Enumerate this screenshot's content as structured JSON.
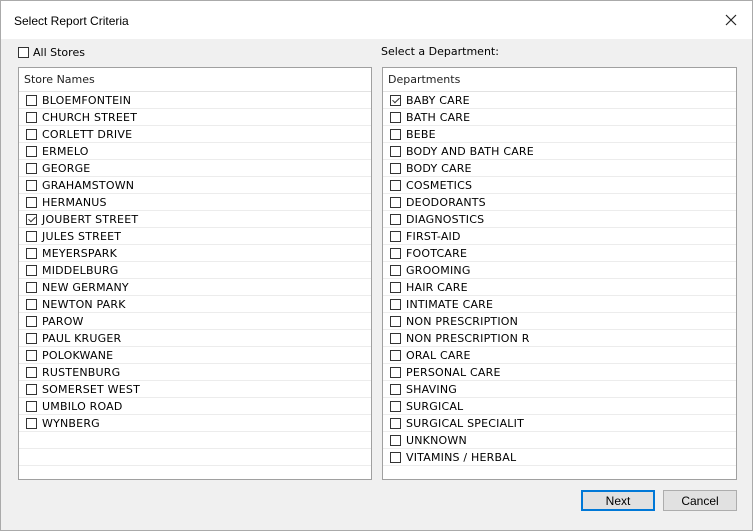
{
  "window": {
    "title": "Select Report Criteria"
  },
  "all_stores": {
    "label": "All Stores",
    "checked": false
  },
  "department_prompt": "Select a Department:",
  "stores": {
    "header": "Store Names",
    "items": [
      {
        "label": "BLOEMFONTEIN",
        "checked": false
      },
      {
        "label": "CHURCH STREET",
        "checked": false
      },
      {
        "label": "CORLETT DRIVE",
        "checked": false
      },
      {
        "label": "ERMELO",
        "checked": false
      },
      {
        "label": "GEORGE",
        "checked": false
      },
      {
        "label": "GRAHAMSTOWN",
        "checked": false
      },
      {
        "label": "HERMANUS",
        "checked": false
      },
      {
        "label": "JOUBERT STREET",
        "checked": true
      },
      {
        "label": "JULES STREET",
        "checked": false
      },
      {
        "label": "MEYERSPARK",
        "checked": false
      },
      {
        "label": "MIDDELBURG",
        "checked": false
      },
      {
        "label": "NEW GERMANY",
        "checked": false
      },
      {
        "label": "NEWTON PARK",
        "checked": false
      },
      {
        "label": "PAROW",
        "checked": false
      },
      {
        "label": "PAUL KRUGER",
        "checked": false
      },
      {
        "label": "POLOKWANE",
        "checked": false
      },
      {
        "label": "RUSTENBURG",
        "checked": false
      },
      {
        "label": "SOMERSET WEST",
        "checked": false
      },
      {
        "label": "UMBILO ROAD",
        "checked": false
      },
      {
        "label": "WYNBERG",
        "checked": false
      }
    ]
  },
  "departments": {
    "header": "Departments",
    "items": [
      {
        "label": "BABY CARE",
        "checked": true
      },
      {
        "label": "BATH CARE",
        "checked": false
      },
      {
        "label": "BEBE",
        "checked": false
      },
      {
        "label": "BODY AND BATH CARE",
        "checked": false
      },
      {
        "label": "BODY CARE",
        "checked": false
      },
      {
        "label": "COSMETICS",
        "checked": false
      },
      {
        "label": "DEODORANTS",
        "checked": false
      },
      {
        "label": "DIAGNOSTICS",
        "checked": false
      },
      {
        "label": "FIRST-AID",
        "checked": false
      },
      {
        "label": "FOOTCARE",
        "checked": false
      },
      {
        "label": "GROOMING",
        "checked": false
      },
      {
        "label": "HAIR CARE",
        "checked": false
      },
      {
        "label": "INTIMATE CARE",
        "checked": false
      },
      {
        "label": "NON PRESCRIPTION",
        "checked": false
      },
      {
        "label": "NON PRESCRIPTION R",
        "checked": false
      },
      {
        "label": "ORAL CARE",
        "checked": false
      },
      {
        "label": "PERSONAL CARE",
        "checked": false
      },
      {
        "label": "SHAVING",
        "checked": false
      },
      {
        "label": "SURGICAL",
        "checked": false
      },
      {
        "label": "SURGICAL SPECIALIT",
        "checked": false
      },
      {
        "label": "UNKNOWN",
        "checked": false
      },
      {
        "label": "VITAMINS / HERBAL",
        "checked": false
      }
    ]
  },
  "buttons": {
    "next": "Next",
    "cancel": "Cancel"
  },
  "colors": {
    "accent": "#0078d7",
    "dialog_bg": "#f0f0f0"
  }
}
